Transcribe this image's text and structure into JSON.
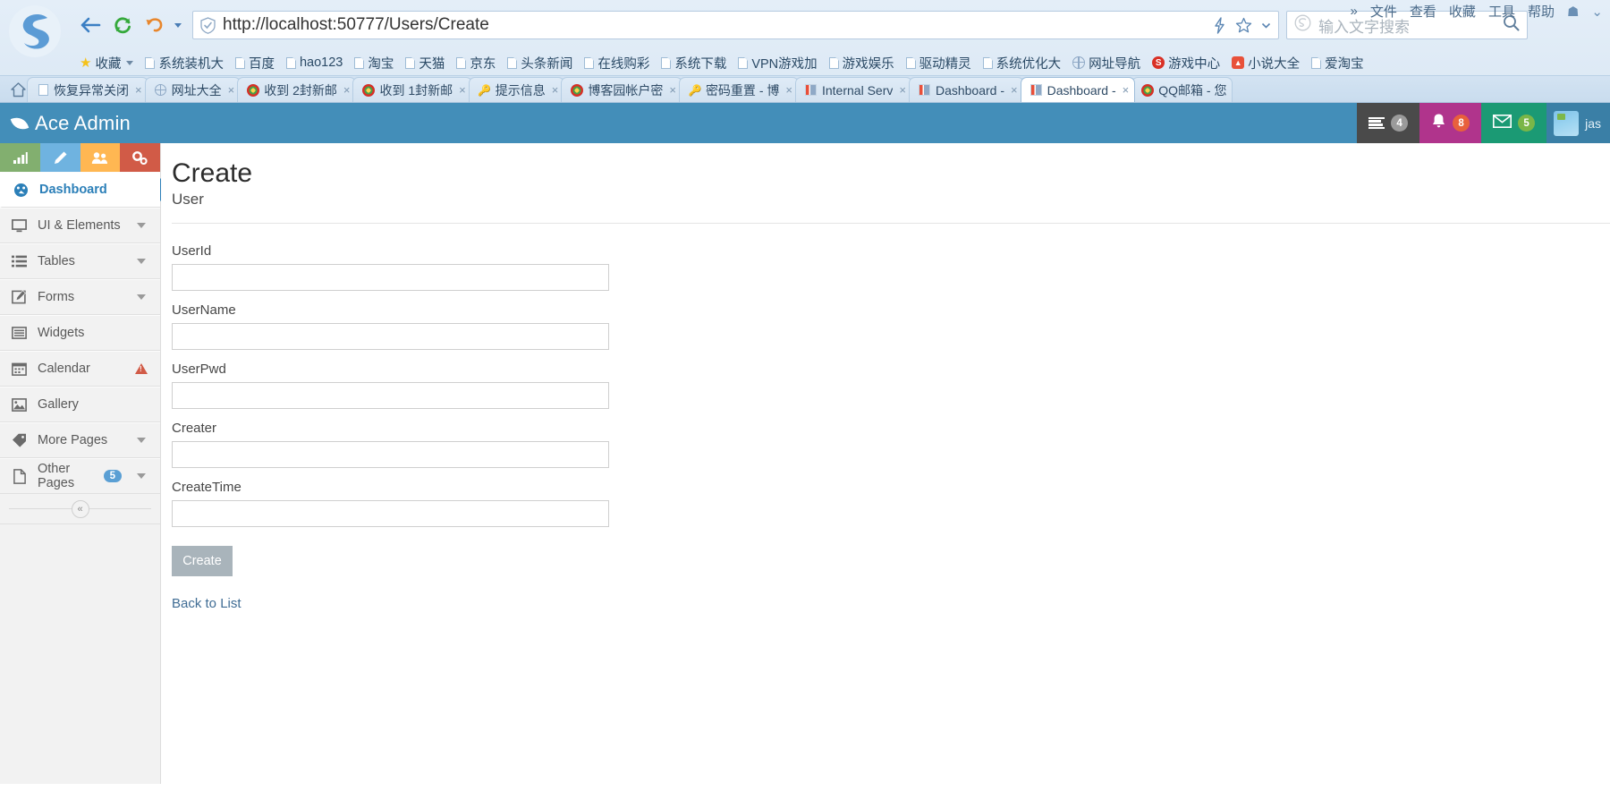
{
  "browser": {
    "address": {
      "url": "http://localhost:50777/Users/Create",
      "shield_icon": "shield-check-icon",
      "lightning_icon": "lightning-icon",
      "star_icon": "star-icon",
      "caret_icon": "chevron-down-icon"
    },
    "search": {
      "placeholder": "输入文字搜索",
      "engine_icon": "sogou-icon",
      "search_icon": "search-icon"
    },
    "menu": [
      {
        "label": "»",
        "name": "overflow"
      },
      {
        "label": "文件",
        "name": "file"
      },
      {
        "label": "查看",
        "name": "view"
      },
      {
        "label": "收藏",
        "name": "favorites"
      },
      {
        "label": "工具",
        "name": "tools"
      },
      {
        "label": "帮助",
        "name": "help"
      }
    ],
    "nav": {
      "back_icon": "arrow-left-icon",
      "refresh_icon": "refresh-icon",
      "undo_icon": "undo-icon",
      "home_icon": "home-icon"
    },
    "bookmarks": [
      {
        "label": "收藏",
        "icon": "star-icon",
        "caret": true
      },
      {
        "label": "系统装机大",
        "icon": "page-icon"
      },
      {
        "label": "百度",
        "icon": "page-icon"
      },
      {
        "label": "hao123",
        "icon": "page-icon"
      },
      {
        "label": "淘宝",
        "icon": "page-icon"
      },
      {
        "label": "天猫",
        "icon": "page-icon"
      },
      {
        "label": "京东",
        "icon": "page-icon"
      },
      {
        "label": "头条新闻",
        "icon": "page-icon"
      },
      {
        "label": "在线购彩",
        "icon": "page-icon"
      },
      {
        "label": "系统下载",
        "icon": "page-icon"
      },
      {
        "label": "VPN游戏加",
        "icon": "page-icon"
      },
      {
        "label": "游戏娱乐",
        "icon": "page-icon"
      },
      {
        "label": "驱动精灵",
        "icon": "page-icon"
      },
      {
        "label": "系统优化大",
        "icon": "page-icon"
      },
      {
        "label": "网址导航",
        "icon": "globe-icon"
      },
      {
        "label": "游戏中心",
        "icon": "sogou-icon"
      },
      {
        "label": "小说大全",
        "icon": "novel-icon"
      },
      {
        "label": "爱淘宝",
        "icon": "page-icon"
      }
    ],
    "tabs": [
      {
        "title": "恢复异常关闭",
        "favicon": "page-icon",
        "active": false
      },
      {
        "title": "网址大全",
        "favicon": "globe-icon",
        "active": false
      },
      {
        "title": "收到 2封新邮",
        "favicon": "firefox-icon",
        "active": false
      },
      {
        "title": "收到 1封新邮",
        "favicon": "firefox-icon",
        "active": false
      },
      {
        "title": "提示信息",
        "favicon": "key-icon",
        "active": false
      },
      {
        "title": "博客园帐户密",
        "favicon": "firefox-icon",
        "active": false
      },
      {
        "title": "密码重置 - 博",
        "favicon": "key-icon",
        "active": false
      },
      {
        "title": "Internal Serv",
        "favicon": "bar-icon",
        "active": false
      },
      {
        "title": "Dashboard -",
        "favicon": "bar-icon",
        "active": false
      },
      {
        "title": "Dashboard -",
        "favicon": "bar-icon",
        "active": true
      },
      {
        "title": "QQ邮箱 - 您",
        "favicon": "firefox-icon",
        "active": false
      }
    ],
    "tab_close_label": "×"
  },
  "app": {
    "brand": "Ace Admin",
    "navbar": {
      "tasks": {
        "icon": "tasks-list-icon",
        "badge": "4",
        "color": "#9b9b9b"
      },
      "notifications": {
        "icon": "bell-icon",
        "badge": "8",
        "color": "#e8603c"
      },
      "messages": {
        "icon": "envelope-icon",
        "badge": "5",
        "color": "#7ab648"
      },
      "user": {
        "name": "jas",
        "avatar": "avatar"
      }
    },
    "shortcuts": [
      {
        "name": "shortcut-chart",
        "icon": "bar-chart-icon",
        "color": "#82af6f"
      },
      {
        "name": "shortcut-edit",
        "icon": "pencil-icon",
        "color": "#6fb3e0"
      },
      {
        "name": "shortcut-users",
        "icon": "group-icon",
        "color": "#ffb752"
      },
      {
        "name": "shortcut-settings",
        "icon": "cogs-icon",
        "color": "#d15b47"
      }
    ],
    "sidebar": {
      "items": [
        {
          "label": "Dashboard",
          "icon": "dashboard-icon",
          "active": true,
          "caret": false,
          "badge": null,
          "warn": false
        },
        {
          "label": "UI & Elements",
          "icon": "desktop-icon",
          "active": false,
          "caret": true,
          "badge": null,
          "warn": false
        },
        {
          "label": "Tables",
          "icon": "list-icon",
          "active": false,
          "caret": true,
          "badge": null,
          "warn": false
        },
        {
          "label": "Forms",
          "icon": "edit-square-icon",
          "active": false,
          "caret": true,
          "badge": null,
          "warn": false
        },
        {
          "label": "Widgets",
          "icon": "widgets-icon",
          "active": false,
          "caret": false,
          "badge": null,
          "warn": false
        },
        {
          "label": "Calendar",
          "icon": "calendar-icon",
          "active": false,
          "caret": false,
          "badge": null,
          "warn": true
        },
        {
          "label": "Gallery",
          "icon": "image-icon",
          "active": false,
          "caret": false,
          "badge": null,
          "warn": false
        },
        {
          "label": "More Pages",
          "icon": "tag-icon",
          "active": false,
          "caret": true,
          "badge": null,
          "warn": false
        },
        {
          "label": "Other Pages",
          "icon": "file-icon",
          "active": false,
          "caret": true,
          "badge": "5",
          "warn": false
        }
      ],
      "collapse_label": "«"
    },
    "page": {
      "title": "Create",
      "subtitle": "User",
      "fields": [
        {
          "label": "UserId",
          "value": "",
          "placeholder": "",
          "name": "userid-field"
        },
        {
          "label": "UserName",
          "value": "",
          "placeholder": "",
          "name": "username-field"
        },
        {
          "label": "UserPwd",
          "value": "",
          "placeholder": "",
          "name": "userpwd-field"
        },
        {
          "label": "Creater",
          "value": "",
          "placeholder": "",
          "name": "creater-field"
        },
        {
          "label": "CreateTime",
          "value": "",
          "placeholder": "",
          "name": "createtime-field"
        }
      ],
      "submit_label": "Create",
      "back_link_label": "Back to List"
    }
  },
  "colors": {
    "navbar": "#438eb9",
    "accent": "#2b7fb8",
    "tasks": "#4a4a4a",
    "bell": "#b0348c",
    "mail": "#1b9a74"
  }
}
